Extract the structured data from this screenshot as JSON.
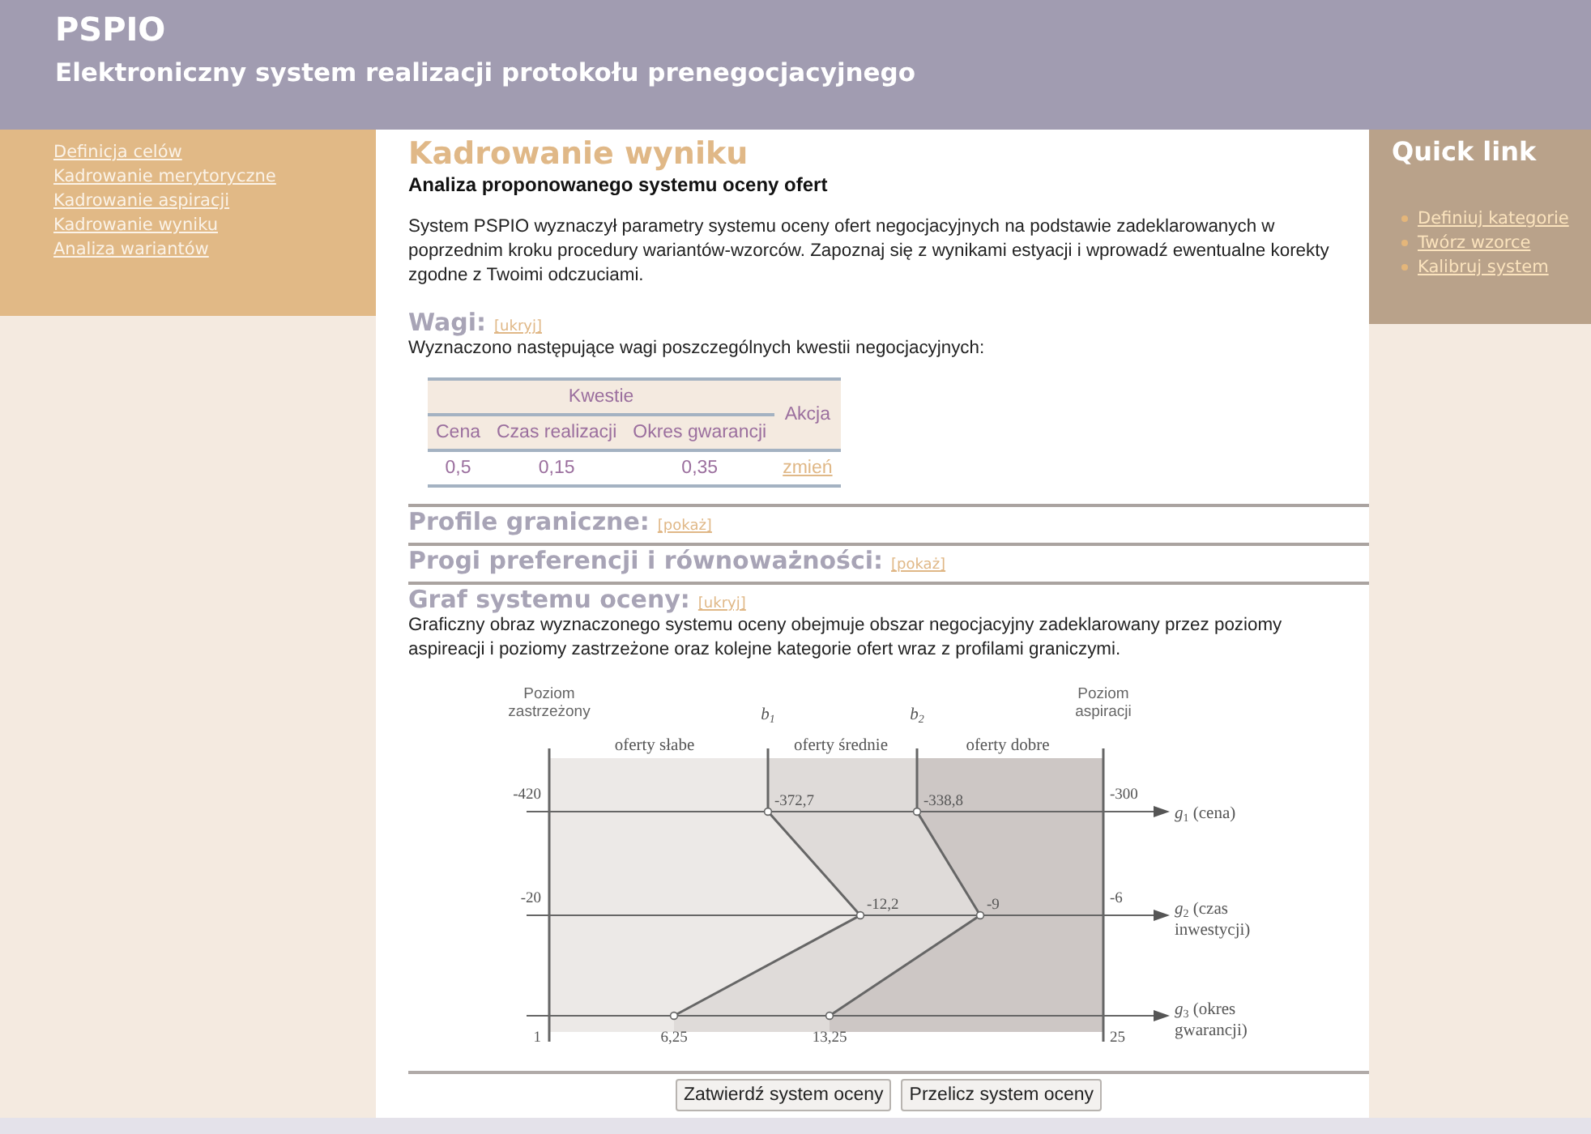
{
  "header": {
    "title": "PSPIO",
    "subtitle": "Elektroniczny system realizacji protokołu prenegocjacyjnego"
  },
  "sidebar": {
    "items": [
      {
        "label": "Definicja celów"
      },
      {
        "label": "Kadrowanie merytoryczne"
      },
      {
        "label": "Kadrowanie aspiracji"
      },
      {
        "label": "Kadrowanie wyniku"
      },
      {
        "label": "Analiza wariantów"
      }
    ]
  },
  "main": {
    "title": "Kadrowanie wyniku",
    "subtitle": "Analiza proponowanego systemu oceny ofert",
    "intro": "System PSPIO wyznaczył parametry systemu oceny ofert negocjacyjnych na podstawie zadeklarowanych w poprzednim kroku procedury wariantów-wzorców. Zapoznaj się z wynikami estyacji i wprowadź ewentualne korekty zgodne z Twoimi odczuciami.",
    "sections": [
      {
        "kind": "weights",
        "title": "Wagi:",
        "toggle": "[ukryj]",
        "text": "Wyznaczono następujące wagi poszczególnych kwestii negocjacyjnych:",
        "table": {
          "group_header": "Kwestie",
          "action_header": "Akcja",
          "columns": [
            "Cena",
            "Czas realizacji",
            "Okres gwarancji"
          ],
          "values": [
            "0,5",
            "0,15",
            "0,35"
          ],
          "action": "zmień"
        }
      },
      {
        "kind": "collapsed",
        "title": "Profile graniczne:",
        "toggle": "[pokaż]"
      },
      {
        "kind": "collapsed",
        "title": "Progi preferencji i równoważności:",
        "toggle": "[pokaż]"
      },
      {
        "kind": "graph",
        "title": "Graf systemu oceny:",
        "toggle": "[ukryj]",
        "text": "Graficzny obraz wyznaczonego systemu oceny obejmuje obszar negocjacyjny zadeklarowany przez poziomy aspireacji i poziomy zastrzeżone oraz kolejne kategorie ofert wraz z profilami graniczymi.",
        "diagram": {
          "reservation_label": [
            "Poziom",
            "zastrzeżony"
          ],
          "aspiration_label": [
            "Poziom",
            "aspiracji"
          ],
          "profiles": [
            {
              "symbol": "b",
              "index": "1"
            },
            {
              "symbol": "b",
              "index": "2"
            }
          ],
          "categories": [
            "oferty słabe",
            "oferty średnie",
            "oferty dobre"
          ],
          "criteria": [
            {
              "symbol": "g",
              "index": "1",
              "lines": [
                "(cena)"
              ],
              "reservation": "-420",
              "b1": "-372,7",
              "b2": "-338,8",
              "aspiration": "-300"
            },
            {
              "symbol": "g",
              "index": "2",
              "lines": [
                "(czas",
                "inwestycji)"
              ],
              "reservation": "-20",
              "b1": "-12,2",
              "b2": "-9",
              "aspiration": "-6"
            },
            {
              "symbol": "g",
              "index": "3",
              "lines": [
                "(okres",
                "gwarancji)"
              ],
              "reservation": "1",
              "b1": "6,25",
              "b2": "13,25",
              "aspiration": "25"
            }
          ]
        }
      }
    ],
    "buttons": [
      "Zatwierdź system oceny",
      "Przelicz system oceny"
    ]
  },
  "quick_links": {
    "title": "Quick link",
    "items": [
      "Definiuj kategorie",
      "Twórz wzorce",
      "Kalibruj system"
    ]
  }
}
